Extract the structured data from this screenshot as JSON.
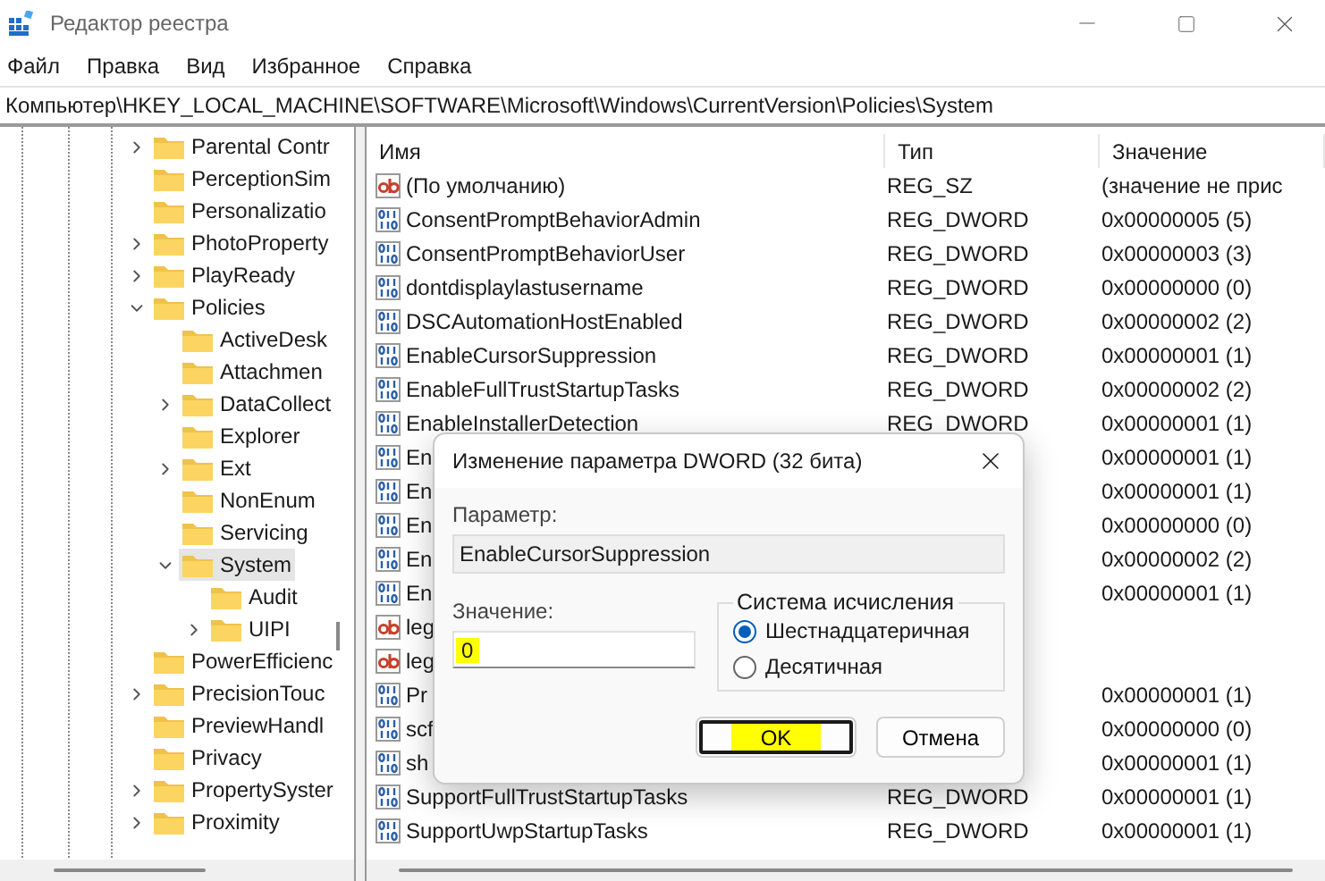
{
  "window": {
    "title": "Редактор реестра"
  },
  "menu": [
    "Файл",
    "Правка",
    "Вид",
    "Избранное",
    "Справка"
  ],
  "address_bar": {
    "path": "Компьютер\\HKEY_LOCAL_MACHINE\\SOFTWARE\\Microsoft\\Windows\\CurrentVersion\\Policies\\System"
  },
  "tree": {
    "items": [
      {
        "label": "Parental Contr",
        "expandable": true,
        "expanded": false,
        "selected": false
      },
      {
        "label": "PerceptionSim",
        "expandable": false,
        "selected": false
      },
      {
        "label": "Personalizatio",
        "expandable": false,
        "selected": false
      },
      {
        "label": "PhotoProperty",
        "expandable": true,
        "expanded": false,
        "selected": false
      },
      {
        "label": "PlayReady",
        "expandable": true,
        "expanded": false,
        "selected": false
      },
      {
        "label": "Policies",
        "expandable": true,
        "expanded": true,
        "selected": false,
        "children": [
          {
            "label": "ActiveDesk",
            "expandable": false,
            "selected": false
          },
          {
            "label": "Attachmen",
            "expandable": false,
            "selected": false
          },
          {
            "label": "DataCollect",
            "expandable": true,
            "expanded": false,
            "selected": false
          },
          {
            "label": "Explorer",
            "expandable": false,
            "selected": false
          },
          {
            "label": "Ext",
            "expandable": true,
            "expanded": false,
            "selected": false
          },
          {
            "label": "NonEnum",
            "expandable": false,
            "selected": false
          },
          {
            "label": "Servicing",
            "expandable": false,
            "selected": false
          },
          {
            "label": "System",
            "expandable": true,
            "expanded": true,
            "selected": true,
            "children": [
              {
                "label": "Audit",
                "expandable": false,
                "selected": false
              },
              {
                "label": "UIPI",
                "expandable": true,
                "expanded": false,
                "selected": false
              }
            ]
          }
        ]
      },
      {
        "label": "PowerEfficienc",
        "expandable": false,
        "selected": false
      },
      {
        "label": "PrecisionTouc",
        "expandable": true,
        "expanded": false,
        "selected": false
      },
      {
        "label": "PreviewHandl",
        "expandable": false,
        "selected": false
      },
      {
        "label": "Privacy",
        "expandable": false,
        "selected": false
      },
      {
        "label": "PropertySyster",
        "expandable": true,
        "expanded": false,
        "selected": false
      },
      {
        "label": "Proximity",
        "expandable": true,
        "expanded": false,
        "selected": false
      }
    ]
  },
  "values_table": {
    "columns": [
      "Имя",
      "Тип",
      "Значение"
    ],
    "rows": [
      {
        "kind": "string",
        "name": "(По умолчанию)",
        "type": "REG_SZ",
        "data": "(значение не прис"
      },
      {
        "kind": "dword",
        "name": "ConsentPromptBehaviorAdmin",
        "type": "REG_DWORD",
        "data": "0x00000005 (5)"
      },
      {
        "kind": "dword",
        "name": "ConsentPromptBehaviorUser",
        "type": "REG_DWORD",
        "data": "0x00000003 (3)"
      },
      {
        "kind": "dword",
        "name": "dontdisplaylastusername",
        "type": "REG_DWORD",
        "data": "0x00000000 (0)"
      },
      {
        "kind": "dword",
        "name": "DSCAutomationHostEnabled",
        "type": "REG_DWORD",
        "data": "0x00000002 (2)"
      },
      {
        "kind": "dword",
        "name": "EnableCursorSuppression",
        "type": "REG_DWORD",
        "data": "0x00000001 (1)"
      },
      {
        "kind": "dword",
        "name": "EnableFullTrustStartupTasks",
        "type": "REG_DWORD",
        "data": "0x00000002 (2)"
      },
      {
        "kind": "dword",
        "name": "EnableInstallerDetection",
        "type": "REG_DWORD",
        "data": "0x00000001 (1)"
      },
      {
        "kind": "dword",
        "name": "En",
        "data": "0x00000001 (1)"
      },
      {
        "kind": "dword",
        "name": "En",
        "data": "0x00000001 (1)"
      },
      {
        "kind": "dword",
        "name": "En",
        "data": "0x00000000 (0)"
      },
      {
        "kind": "dword",
        "name": "En",
        "data": "0x00000002 (2)"
      },
      {
        "kind": "dword",
        "name": "En",
        "data": "0x00000001 (1)"
      },
      {
        "kind": "string",
        "name": "leg"
      },
      {
        "kind": "string",
        "name": "leg"
      },
      {
        "kind": "dword",
        "name": "Pr",
        "data": "0x00000001 (1)"
      },
      {
        "kind": "dword",
        "name": "scf",
        "data": "0x00000000 (0)"
      },
      {
        "kind": "dword",
        "name": "sh",
        "data": "0x00000001 (1)"
      },
      {
        "kind": "dword",
        "name": "SupportFullTrustStartupTasks",
        "type": "REG_DWORD",
        "data": "0x00000001 (1)"
      },
      {
        "kind": "dword",
        "name": "SupportUwpStartupTasks",
        "type": "REG_DWORD",
        "data": "0x00000001 (1)"
      }
    ]
  },
  "dialog": {
    "title": "Изменение параметра DWORD (32 бита)",
    "parameter_label": "Параметр:",
    "parameter_value": "EnableCursorSuppression",
    "value_label": "Значение:",
    "value": "0",
    "value_highlighted": true,
    "base_group": {
      "title": "Система исчисления",
      "options": [
        {
          "label": "Шестнадцатеричная",
          "selected": true
        },
        {
          "label": "Десятичная",
          "selected": false
        }
      ]
    },
    "buttons": [
      {
        "label": "OK",
        "default": true,
        "highlighted": true
      },
      {
        "label": "Отмена",
        "default": false,
        "highlighted": false
      }
    ]
  }
}
